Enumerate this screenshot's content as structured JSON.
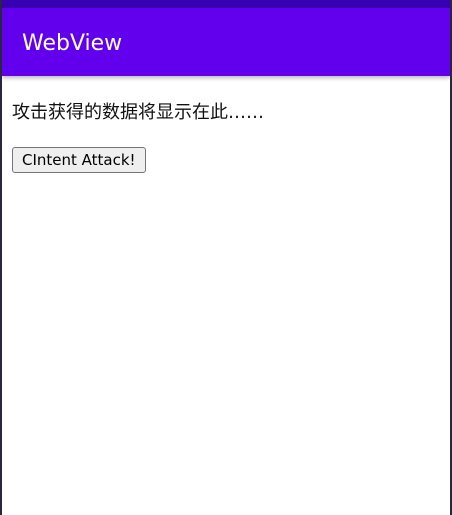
{
  "app_bar": {
    "title": "WebView"
  },
  "content": {
    "result_text": "攻击获得的数据将显示在此……",
    "attack_button_label": "CIntent Attack!"
  },
  "colors": {
    "status_bar": "#3700b3",
    "app_bar": "#6200ee",
    "background": "#ffffff"
  }
}
